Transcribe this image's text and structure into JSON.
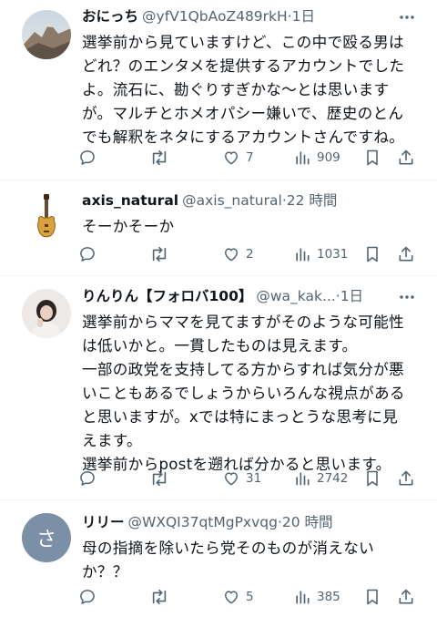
{
  "tweets": [
    {
      "name": "おにっち",
      "handle": "@yfV1QbAoZ489rkH",
      "sep": "·",
      "time": "1日",
      "avatar": "mountain-avatar",
      "text": "選挙前から見ていますけど、この中で殴る男は\nどれ？のエンタメを提供するアカウントでした\nよ。流石に、勘ぐりすぎかな〜とは思います\nが。マルチとホメオパシー嫌いで、歴史のとん\nでも解釈をネタにするアカウントさんですね。",
      "replies": "",
      "retweets": "",
      "likes": "7",
      "views": "909"
    },
    {
      "name": "axis_natural",
      "handle": "@axis_natural",
      "sep": "·",
      "time": "22 時間",
      "avatar": "guitar-avatar",
      "text": "そーかそーか",
      "replies": "",
      "retweets": "",
      "likes": "2",
      "views": "1031"
    },
    {
      "name": "りんりん【フォロバ100】",
      "handle": "@wa_kak...",
      "sep": "·",
      "time": "1日",
      "avatar": "person-avatar",
      "text": "選挙前からママを見てますがそのような可能性\nは低いかと。一貫したものは見えます。\n一部の政党を支持してる方からすれば気分が悪\nいこともあるでしょうからいろんな視点がある\nと思いますが。xでは特にまっとうな思考に見\nえます。\n選挙前からpostを遡れば分かると思います。",
      "replies": "",
      "retweets": "",
      "likes": "31",
      "views": "2742"
    },
    {
      "name": "リリー",
      "handle": "@WXQI37qtMgPxvqg",
      "sep": "·",
      "time": "20 時間",
      "avatar": "letter-avatar",
      "avatar_letter": "さ",
      "text": "母の指摘を除いたら党そのものが消えない\nか？？",
      "replies": "",
      "retweets": "",
      "likes": "5",
      "views": "385"
    }
  ],
  "colors": {
    "text": "#0f1419",
    "muted": "#536471",
    "divider": "#eff3f4",
    "letter_avatar_bg": "#7b8fa6"
  }
}
